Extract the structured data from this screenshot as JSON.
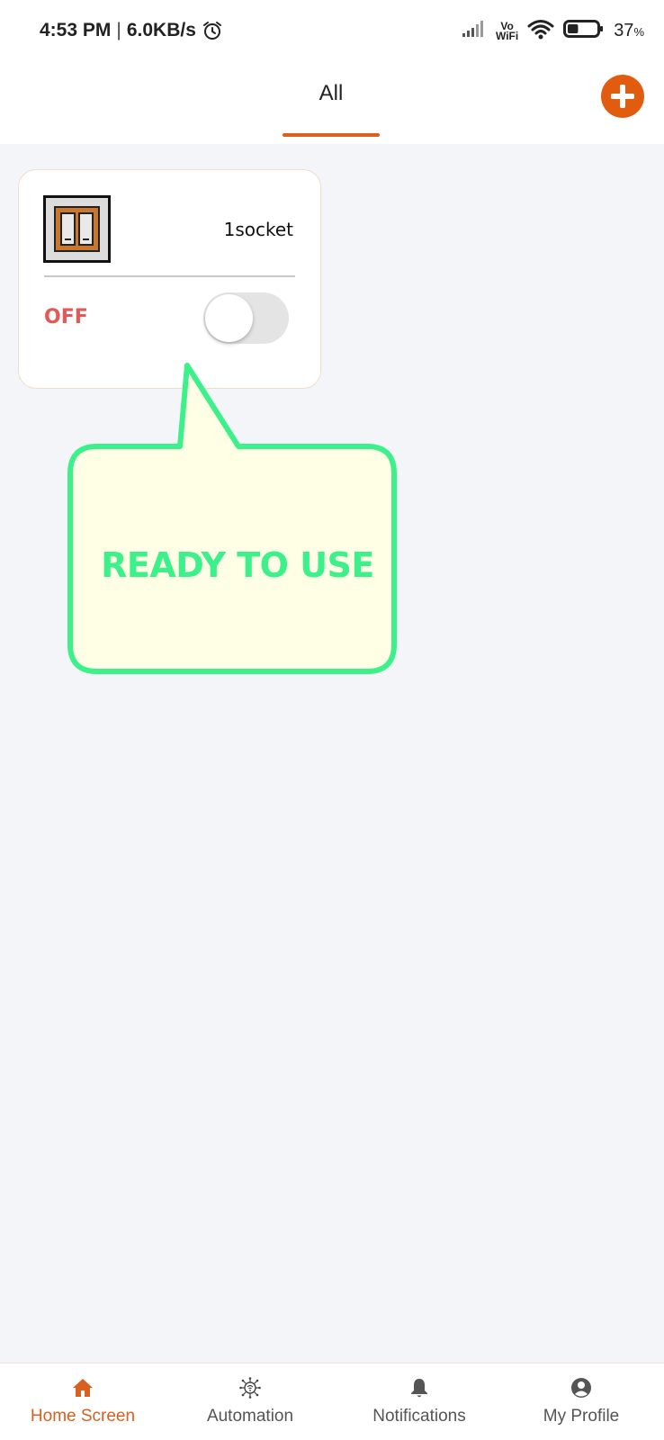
{
  "status_bar": {
    "time": "4:53 PM",
    "separator": "|",
    "network_speed": "6.0KB/s",
    "vowifi_top": "Vo",
    "vowifi_bottom": "WiFi",
    "battery_value": "37",
    "battery_unit": "%",
    "battery_level": 0.37,
    "icons": [
      "alarm-icon",
      "signal-icon",
      "vowifi-icon",
      "wifi-icon",
      "battery-icon"
    ]
  },
  "header": {
    "tabs": [
      {
        "label": "All",
        "active": true
      }
    ],
    "accent_color": "#d9601e",
    "add_button_icon": "plus-icon",
    "add_button_color": "#e25c10"
  },
  "device_card": {
    "icon": "wall-switch-icon",
    "name": "1socket",
    "state_label": "OFF",
    "state_color": "#e05a5a",
    "toggle_on": false
  },
  "callout": {
    "text": "READY TO USE",
    "text_color": "#3cf08a",
    "fill_color": "#ffffe6",
    "border_color": "#3cf08a"
  },
  "bottom_nav": {
    "items": [
      {
        "label": "Home Screen",
        "icon": "home-icon",
        "active": true
      },
      {
        "label": "Automation",
        "icon": "automation-icon",
        "active": false
      },
      {
        "label": "Notifications",
        "icon": "bell-icon",
        "active": false
      },
      {
        "label": "My Profile",
        "icon": "user-icon",
        "active": false
      }
    ]
  }
}
